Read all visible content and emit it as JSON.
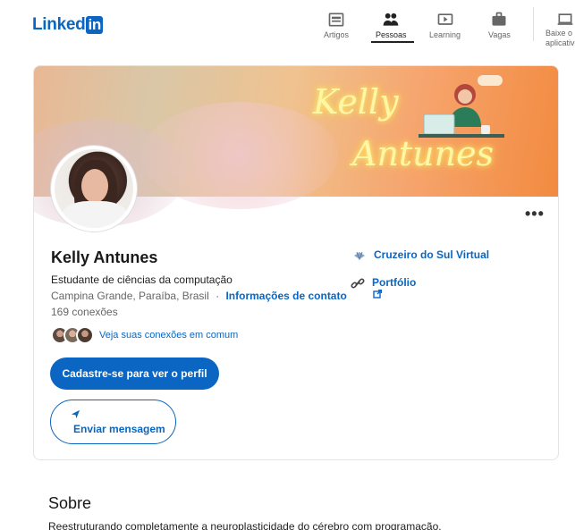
{
  "header": {
    "logo_text": "Linked",
    "logo_badge": "in",
    "nav": [
      {
        "label": "Artigos",
        "icon": "articles-icon"
      },
      {
        "label": "Pessoas",
        "icon": "people-icon",
        "active": true
      },
      {
        "label": "Learning",
        "icon": "learning-icon"
      },
      {
        "label": "Vagas",
        "icon": "jobs-icon"
      }
    ],
    "more_label": "Baixe o aplicativo"
  },
  "profile": {
    "banner_text_line1": "Kelly",
    "banner_text_line2": "Antunes",
    "name": "Kelly Antunes",
    "headline": "Estudante de ciências da computação",
    "location": "Campina Grande, Paraíba, Brasil",
    "separator": "·",
    "contact_info_link": "Informações de contato",
    "connections": "169 conexões",
    "mutual_connections": "Veja suas conexões em comum",
    "primary_button": "Cadastre-se para ver o perfil",
    "message_button": "Enviar mensagem",
    "company": "Cruzeiro do Sul Virtual",
    "website_label": "Portfólio"
  },
  "about": {
    "title": "Sobre",
    "text": "Reestruturando completamente a neuroplasticidade do cérebro com programação."
  },
  "colors": {
    "brand_blue": "#0a66c2",
    "banner_orange": "#f28a3f"
  }
}
